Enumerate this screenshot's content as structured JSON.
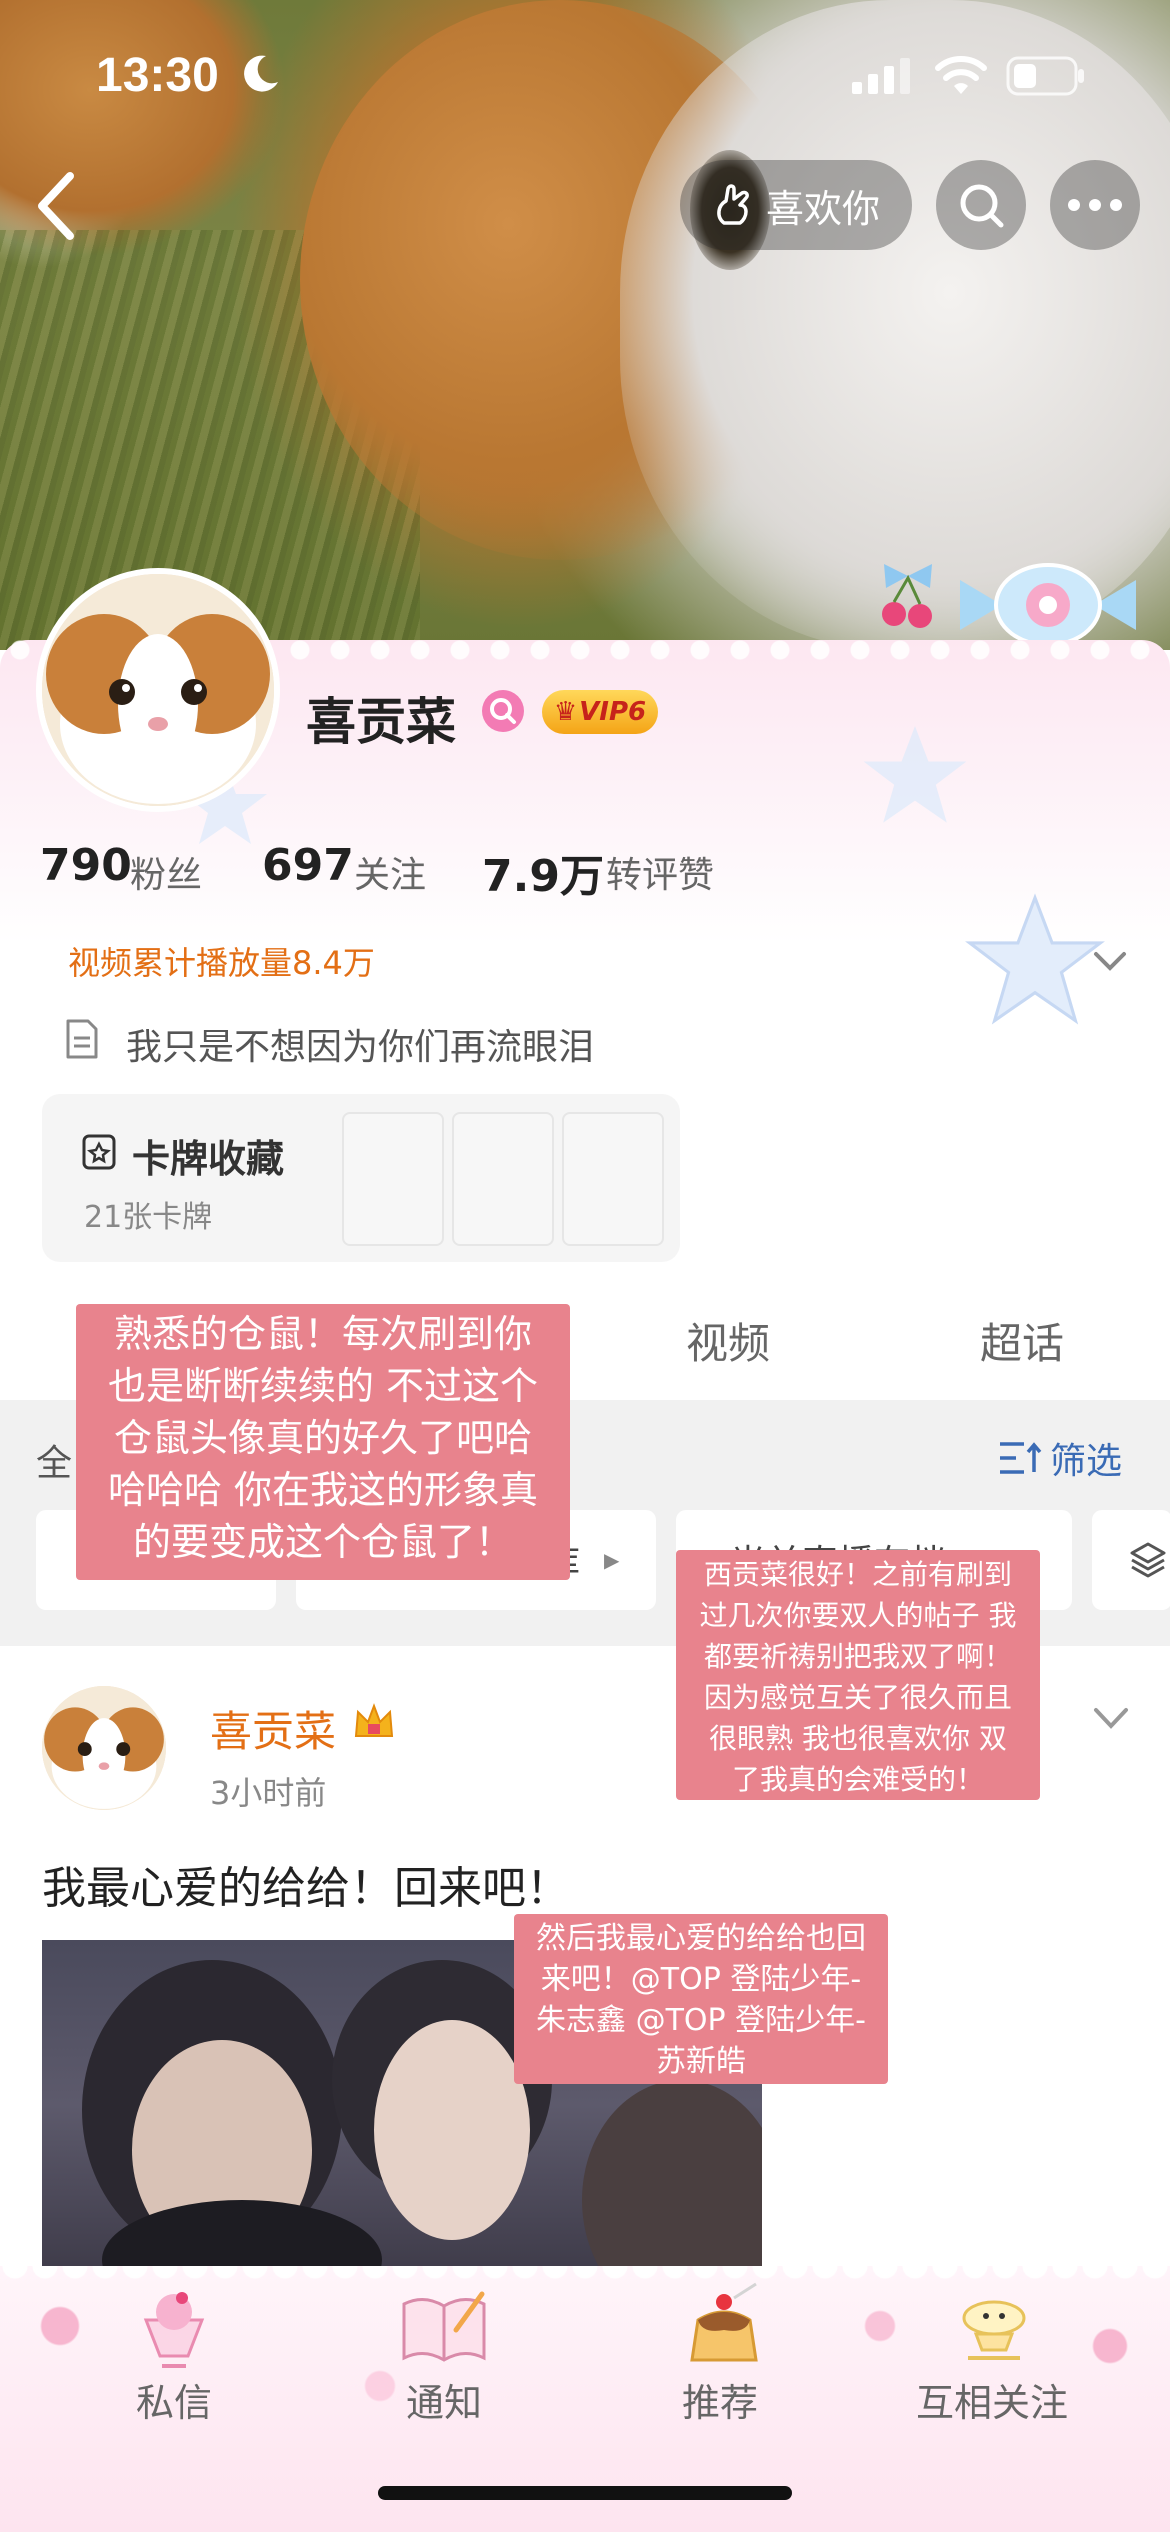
{
  "status_bar": {
    "time": "13:30"
  },
  "top_nav": {
    "like_label": "喜欢你"
  },
  "profile": {
    "name": "喜贡菜",
    "vip_label": "VIP6",
    "stats": [
      {
        "value": "790",
        "label": "粉丝"
      },
      {
        "value": "697",
        "label": "关注"
      },
      {
        "value": "7.9万",
        "label": "转评赞"
      }
    ],
    "video_play_count": "视频累计播放量8.4万",
    "bio": "我只是不想因为你们再流眼泪",
    "cards": {
      "title": "卡牌收藏",
      "count": "21张卡牌"
    }
  },
  "tabs": [
    "视频",
    "超话"
  ],
  "filter": {
    "all_label": "全",
    "filter_label": "筛选",
    "chip_text": "光关直播存档",
    "chip_text2": "库"
  },
  "post": {
    "author": "喜贡菜",
    "time": "3小时前",
    "text": "我最心爱的给给！回来吧！"
  },
  "notes": {
    "note1": "熟悉的仓鼠！每次刷到你\n也是断断续续的 不过这个\n仓鼠头像真的好久了吧哈\n哈哈哈 你在我这的形象真\n的要变成这个仓鼠了！",
    "note2": "西贡菜很好！之前有刷到\n过几次你要双人的帖子 我\n都要祈祷别把我双了啊！\n因为感觉互关了很久而且\n很眼熟 我也很喜欢你 双\n了我真的会难受的！",
    "note3": "然后我最心爱的给给也回\n来吧！@TOP 登陆少年-\n朱志鑫 @TOP 登陆少年-\n苏新皓"
  },
  "bottom_bar": {
    "items": [
      {
        "label": "私信",
        "icon": "ice-cream-icon"
      },
      {
        "label": "通知",
        "icon": "book-icon"
      },
      {
        "label": "推荐",
        "icon": "pudding-icon"
      },
      {
        "label": "互相关注",
        "icon": "cake-icon"
      }
    ]
  },
  "colors": {
    "orange": "#e36f15",
    "note_pink": "#e8838d",
    "filter_blue": "#3a6bb5"
  }
}
